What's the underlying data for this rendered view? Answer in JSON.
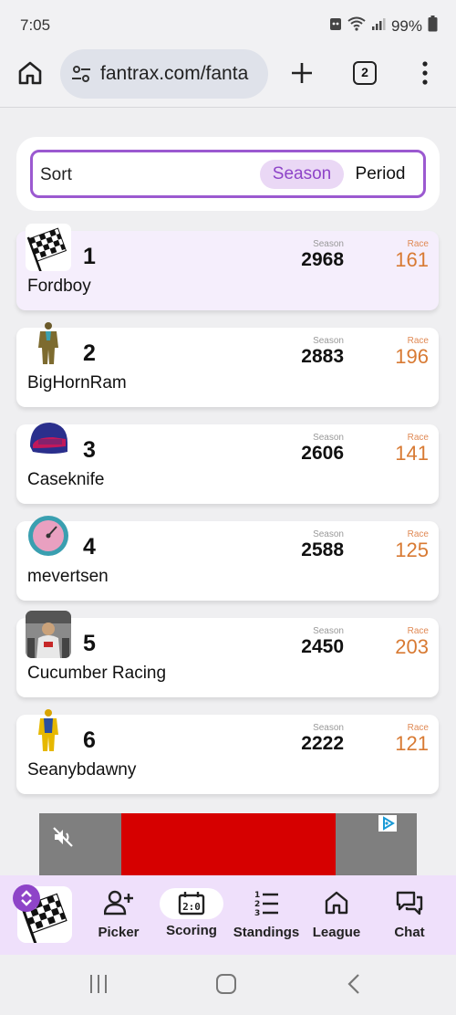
{
  "status_bar": {
    "time": "7:05",
    "battery": "99%"
  },
  "browser": {
    "url": "fantrax.com/fanta",
    "tab_count": "2"
  },
  "sort": {
    "label": "Sort",
    "options": [
      "Season",
      "Period"
    ],
    "selected": "Season"
  },
  "teams": [
    {
      "rank": "1",
      "name": "Fordboy",
      "season_label": "Season",
      "season": "2968",
      "race_label": "Race",
      "race": "161"
    },
    {
      "rank": "2",
      "name": "BigHornRam",
      "season_label": "Season",
      "season": "2883",
      "race_label": "Race",
      "race": "196"
    },
    {
      "rank": "3",
      "name": "Caseknife",
      "season_label": "Season",
      "season": "2606",
      "race_label": "Race",
      "race": "141"
    },
    {
      "rank": "4",
      "name": "mevertsen",
      "season_label": "Season",
      "season": "2588",
      "race_label": "Race",
      "race": "125"
    },
    {
      "rank": "5",
      "name": "Cucumber Racing",
      "season_label": "Season",
      "season": "2450",
      "race_label": "Race",
      "race": "203"
    },
    {
      "rank": "6",
      "name": "Seanybdawny",
      "season_label": "Season",
      "season": "2222",
      "race_label": "Race",
      "race": "121"
    }
  ],
  "bottom_nav": [
    {
      "label": "Picker",
      "icon": "add-person-icon"
    },
    {
      "label": "Scoring",
      "icon": "scoreboard-icon",
      "active": true
    },
    {
      "label": "Standings",
      "icon": "ranked-list-icon"
    },
    {
      "label": "League",
      "icon": "home-icon"
    },
    {
      "label": "Chat",
      "icon": "chat-icon"
    }
  ],
  "colors": {
    "accent": "#8e44c8",
    "race": "#d87a33",
    "highlight": "#f5eefc"
  }
}
